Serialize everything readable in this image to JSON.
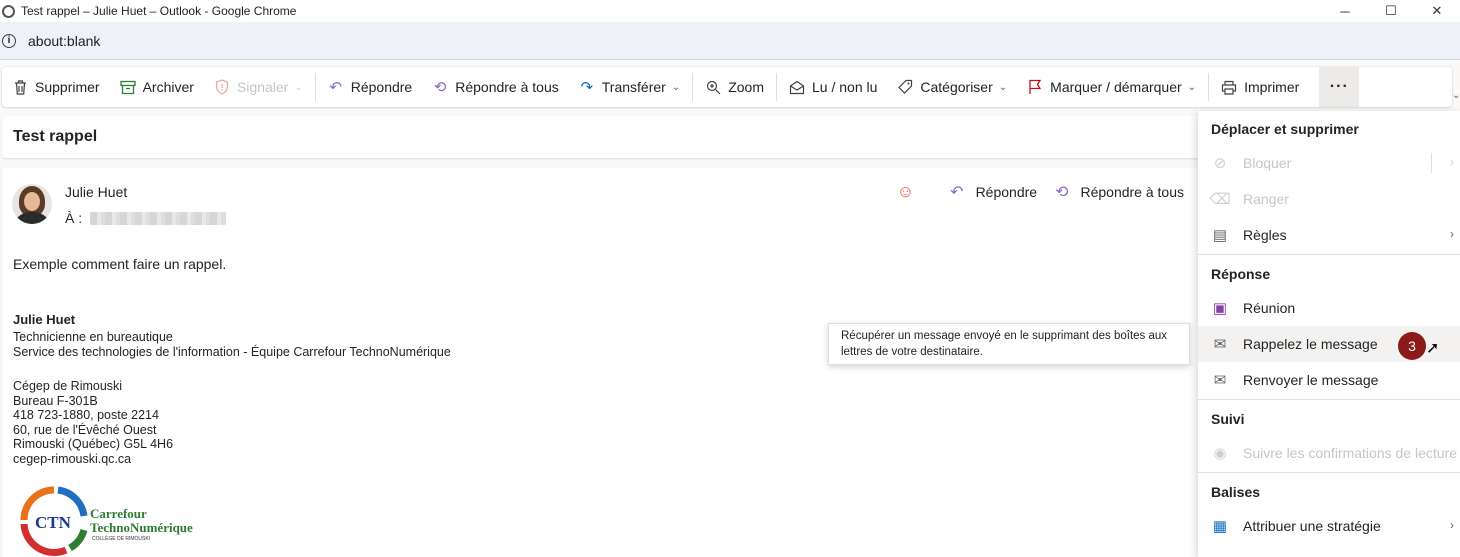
{
  "window": {
    "title": "Test rappel – Julie Huet – Outlook - Google Chrome",
    "minimize": "─",
    "maximize": "☐",
    "close": "✕"
  },
  "address": {
    "url": "about:blank"
  },
  "toolbar": {
    "supprimer": "Supprimer",
    "archiver": "Archiver",
    "signaler": "Signaler",
    "repondre": "Répondre",
    "repondre_tous": "Répondre à tous",
    "transferer": "Transférer",
    "zoom": "Zoom",
    "lu_non_lu": "Lu / non lu",
    "categoriser": "Catégoriser",
    "marquer": "Marquer / démarquer",
    "imprimer": "Imprimer",
    "more": "···"
  },
  "message": {
    "subject": "Test rappel",
    "sender": "Julie Huet",
    "to_label": "À :",
    "actions": {
      "repondre": "Répondre",
      "repondre_tous": "Répondre à tous"
    },
    "body": "Exemple comment faire un rappel.",
    "signature": {
      "name": "Julie Huet",
      "title": "Technicienne en bureautique",
      "department": "Service des technologies de l'information - Équipe Carrefour TechnoNumérique",
      "org": "Cégep de Rimouski",
      "office": "Bureau F-301B",
      "phone": "418 723-1880, poste 2214",
      "street": "60, rue de l'Évêché Ouest",
      "city": "Rimouski (Québec) G5L 4H6",
      "website": "cegep-rimouski.qc.ca"
    },
    "logo": {
      "abbr": "CTN",
      "line1": "Carrefour",
      "line2": "TechnoNumérique",
      "line3": "COLLÈGE DE RIMOUSKI"
    }
  },
  "tooltip": {
    "text": "Récupérer un message envoyé en le supprimant des boîtes aux lettres de votre destinataire."
  },
  "menu": {
    "section1": "Déplacer et supprimer",
    "bloquer": "Bloquer",
    "ranger": "Ranger",
    "regles": "Règles",
    "section2": "Réponse",
    "reunion": "Réunion",
    "rappelez": "Rappelez le message",
    "renvoyer": "Renvoyer le message",
    "section3": "Suivi",
    "suivre": "Suivre les confirmations de lecture",
    "section4": "Balises",
    "attribuer": "Attribuer une stratégie"
  },
  "badge": {
    "number": "3",
    "color": "#8b1a1a"
  },
  "colors": {
    "accent": "#8a6ac6",
    "flag": "#c50f1f",
    "archive": "#2e7d32"
  }
}
